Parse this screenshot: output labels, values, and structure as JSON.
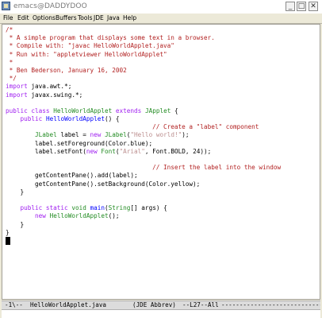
{
  "window": {
    "title": "emacs@DADDYDOO",
    "minimize_glyph": "_",
    "maximize_glyph": "□",
    "close_glyph": "✕"
  },
  "menu": [
    "File",
    "Edit",
    "Options",
    "Buffers",
    "Tools",
    "JDE",
    "Java",
    "Help"
  ],
  "code_lines": [
    [
      [
        "comment",
        "/*"
      ]
    ],
    [
      [
        "comment",
        " * A simple program that displays some text in a browser."
      ]
    ],
    [
      [
        "comment",
        " * Compile with: \"javac HelloWorldApplet.java\""
      ]
    ],
    [
      [
        "comment",
        " * Run with: \"appletviewer HelloWorldApplet\""
      ]
    ],
    [
      [
        "comment",
        " *"
      ]
    ],
    [
      [
        "comment",
        " * Ben Bederson, January 16, 2002"
      ]
    ],
    [
      [
        "comment",
        " */"
      ]
    ],
    [
      [
        "keyword",
        "import"
      ],
      [
        "plain",
        " java.awt.*;"
      ]
    ],
    [
      [
        "keyword",
        "import"
      ],
      [
        "plain",
        " javax.swing.*;"
      ]
    ],
    [
      [
        "plain",
        ""
      ]
    ],
    [
      [
        "keyword",
        "public class"
      ],
      [
        "plain",
        " "
      ],
      [
        "type",
        "HelloWorldApplet"
      ],
      [
        "plain",
        " "
      ],
      [
        "keyword",
        "extends"
      ],
      [
        "plain",
        " "
      ],
      [
        "type",
        "JApplet"
      ],
      [
        "plain",
        " {"
      ]
    ],
    [
      [
        "plain",
        "    "
      ],
      [
        "keyword",
        "public"
      ],
      [
        "plain",
        " "
      ],
      [
        "func",
        "HelloWorldApplet"
      ],
      [
        "plain",
        "() {"
      ]
    ],
    [
      [
        "plain",
        "                                        "
      ],
      [
        "comment",
        "// Create a \"label\" component"
      ]
    ],
    [
      [
        "plain",
        "        "
      ],
      [
        "type",
        "JLabel"
      ],
      [
        "plain",
        " label = "
      ],
      [
        "keyword",
        "new"
      ],
      [
        "plain",
        " "
      ],
      [
        "type",
        "JLabel"
      ],
      [
        "plain",
        "("
      ],
      [
        "string",
        "\"Hello world!\""
      ],
      [
        "plain",
        ");"
      ]
    ],
    [
      [
        "plain",
        "        label.setForeground(Color.blue);"
      ]
    ],
    [
      [
        "plain",
        "        label.setFont("
      ],
      [
        "keyword",
        "new"
      ],
      [
        "plain",
        " "
      ],
      [
        "type",
        "Font"
      ],
      [
        "plain",
        "("
      ],
      [
        "string",
        "\"Arial\""
      ],
      [
        "plain",
        ", Font.BOLD, 24));"
      ]
    ],
    [
      [
        "plain",
        ""
      ]
    ],
    [
      [
        "plain",
        "                                        "
      ],
      [
        "comment",
        "// Insert the label into the window"
      ]
    ],
    [
      [
        "plain",
        "        getContentPane().add(label);"
      ]
    ],
    [
      [
        "plain",
        "        getContentPane().setBackground(Color.yellow);"
      ]
    ],
    [
      [
        "plain",
        "    }"
      ]
    ],
    [
      [
        "plain",
        ""
      ]
    ],
    [
      [
        "plain",
        "    "
      ],
      [
        "keyword",
        "public static"
      ],
      [
        "plain",
        " "
      ],
      [
        "type",
        "void"
      ],
      [
        "plain",
        " "
      ],
      [
        "func",
        "main"
      ],
      [
        "plain",
        "("
      ],
      [
        "type",
        "String"
      ],
      [
        "plain",
        "[] args) {"
      ]
    ],
    [
      [
        "plain",
        "        "
      ],
      [
        "keyword",
        "new"
      ],
      [
        "plain",
        " "
      ],
      [
        "type",
        "HelloWorldApplet"
      ],
      [
        "plain",
        "();"
      ]
    ],
    [
      [
        "plain",
        "    }"
      ]
    ],
    [
      [
        "plain",
        "}"
      ]
    ]
  ],
  "colors": {
    "comment": "#b22222",
    "keyword": "#a020f0",
    "string": "#bc8f8f",
    "type": "#228b22",
    "func": "#0000ff"
  },
  "modeline": {
    "status": "-1\\--",
    "buffer_name": "HelloWorldApplet.java",
    "mode": "(JDE Abbrev)",
    "position": "--L27--All",
    "fill": "-------------------------------------"
  }
}
